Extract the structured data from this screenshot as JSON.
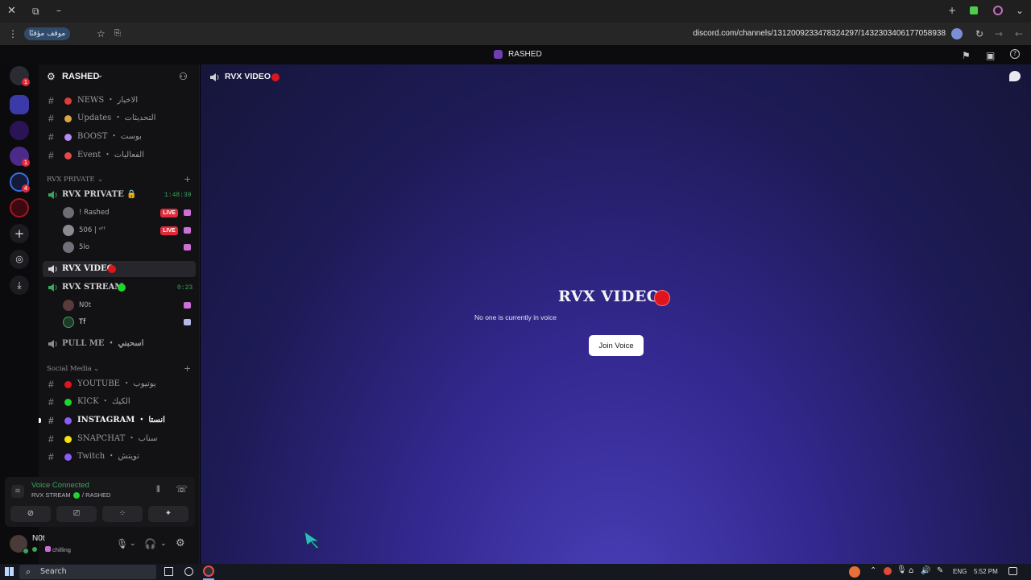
{
  "browser": {
    "site_info": "موقف مؤقتًا",
    "url": "discord.com/channels/1312009233478324297/1432303406177058938"
  },
  "titlebar": {
    "title": "RASHED"
  },
  "server": {
    "name": "RASHED"
  },
  "text_channels_top": [
    {
      "label": "NEWS ・ الاخبار",
      "icon": "pin-icon",
      "color": "#e03b3b"
    },
    {
      "label": "Updates ・ التحديثات",
      "icon": "person-icon",
      "color": "#d9a441"
    },
    {
      "label": "BOOST ・ بوست",
      "icon": "gem-icon",
      "color": "#b58cf0"
    },
    {
      "label": "Event ・ الفعاليات",
      "icon": "tent-icon",
      "color": "#e04a4a"
    }
  ],
  "categories": {
    "private": "RVX PRIVATE",
    "social": "Social Media"
  },
  "voice": {
    "private_channel": {
      "label": "RVX PRIVATE 🔒",
      "timer": "1:48:39"
    },
    "private_users": [
      {
        "name": "! Rashed",
        "live": "LIVE"
      },
      {
        "name": "506 | ᵒᶠᶠ",
        "live": "LIVE"
      },
      {
        "name": "5lo",
        "live": ""
      }
    ],
    "video_channel": {
      "label": "RVX VIDEO"
    },
    "stream_channel": {
      "label": "RVX STREAM",
      "timer": "0:23"
    },
    "stream_users": [
      {
        "name": "N0t"
      },
      {
        "name": "Tf"
      }
    ],
    "pull_channel": {
      "label": "PULL ME ・ اسحبني"
    }
  },
  "social_channels": [
    {
      "label": "YOUTUBE ・ يوتيوب",
      "color": "#e0151c"
    },
    {
      "label": "KICK ・ الكيك",
      "color": "#1ed52a"
    },
    {
      "label": "INSTAGRAM ・ انستا",
      "color": "#8b5cf6"
    },
    {
      "label": "SNAPCHAT ・ سناب",
      "color": "#f7e210"
    },
    {
      "label": "Twitch ・ تويتش",
      "color": "#8b5cf6"
    }
  ],
  "voice_panel": {
    "status": "Voice Connected",
    "channel": "RVX STREAM",
    "server": "/ RASHED"
  },
  "user": {
    "name": "N0t",
    "status": "chilling"
  },
  "main": {
    "header": "RVX VIDEO",
    "title": "RVX VIDEO",
    "subtitle": "No one is currently in voice",
    "join_label": "Join Voice"
  },
  "taskbar": {
    "search_label": "Search",
    "lang": "ENG",
    "time": "5:52 PM"
  },
  "colors": {
    "live_red": "#e02a3a",
    "online_green": "#3ba55c",
    "accent": "#5865f2"
  }
}
